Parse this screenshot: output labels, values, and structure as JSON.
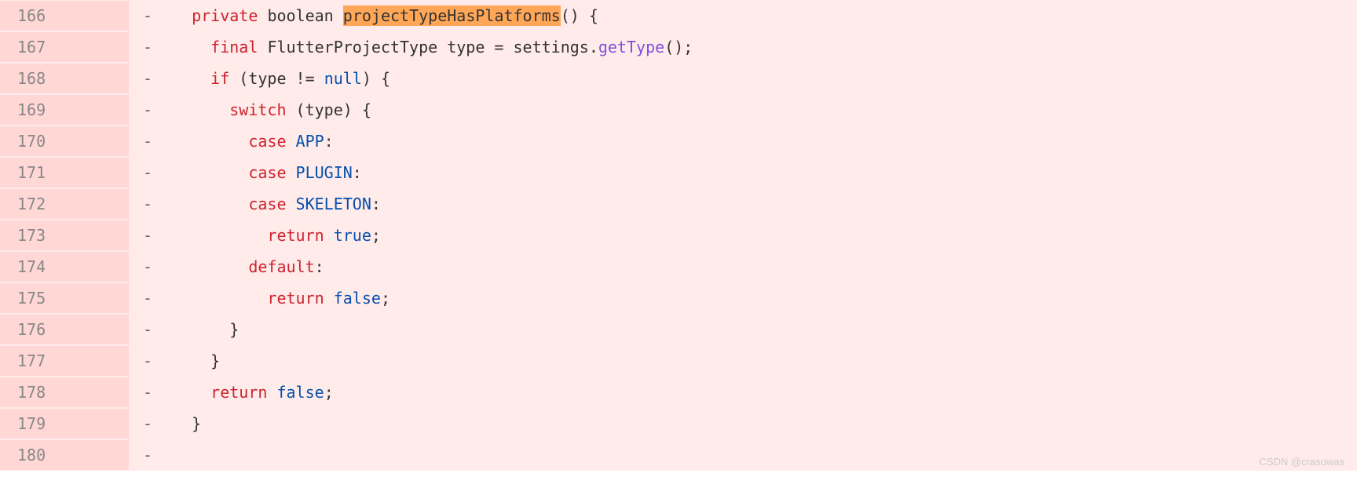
{
  "watermark": "CSDN @crasowas",
  "lines": [
    {
      "num": "166",
      "marker": "-"
    },
    {
      "num": "167",
      "marker": "-"
    },
    {
      "num": "168",
      "marker": "-"
    },
    {
      "num": "169",
      "marker": "-"
    },
    {
      "num": "170",
      "marker": "-"
    },
    {
      "num": "171",
      "marker": "-"
    },
    {
      "num": "172",
      "marker": "-"
    },
    {
      "num": "173",
      "marker": "-"
    },
    {
      "num": "174",
      "marker": "-"
    },
    {
      "num": "175",
      "marker": "-"
    },
    {
      "num": "176",
      "marker": "-"
    },
    {
      "num": "177",
      "marker": "-"
    },
    {
      "num": "178",
      "marker": "-"
    },
    {
      "num": "179",
      "marker": "-"
    },
    {
      "num": "180",
      "marker": "-"
    }
  ],
  "tokens": {
    "private": "private",
    "boolean": "boolean",
    "projectTypeHasPlatforms": "projectTypeHasPlatforms",
    "final": "final",
    "FlutterProjectType": "FlutterProjectType",
    "type_eq": " type = settings.",
    "getType": "getType",
    "if": "if",
    "type_ne": " (type != ",
    "null": "null",
    "switch": "switch",
    "switch_type": " (type) {",
    "case": "case",
    "APP": "APP",
    "PLUGIN": "PLUGIN",
    "SKELETON": "SKELETON",
    "return": "return",
    "true": "true",
    "false": "false",
    "default": "default",
    "colon": ":",
    "semicolon": ";",
    "open_paren_brace": "() {",
    "close_paren_brace": ") {",
    "close_brace": "}",
    "space2": "  ",
    "space4": "    ",
    "space6": "      ",
    "space8": "        ",
    "space10": "          "
  }
}
